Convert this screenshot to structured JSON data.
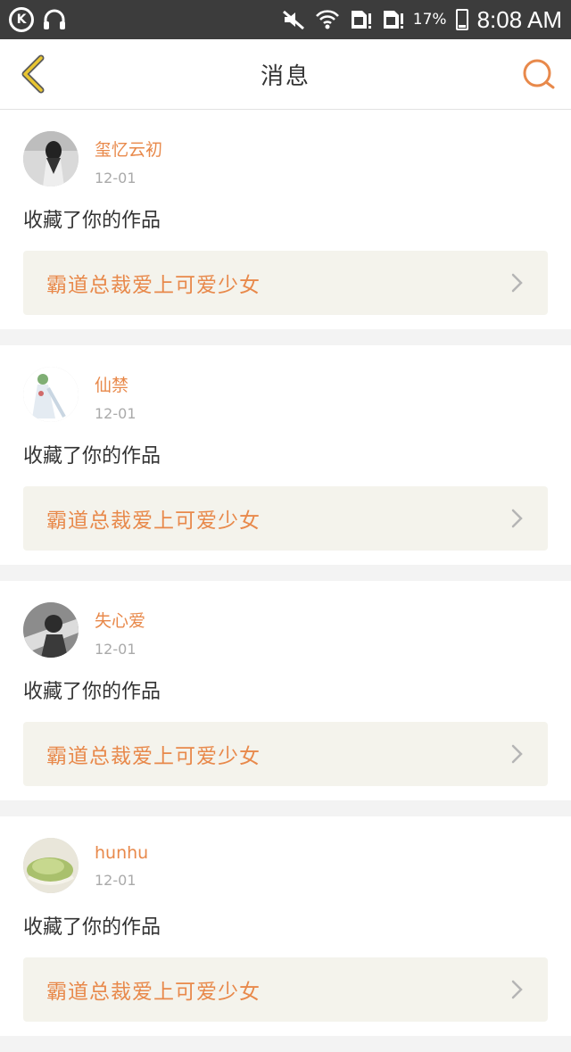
{
  "status_bar": {
    "left_icon_letter": "K",
    "headphones_icon": "headphones-icon",
    "battery_percent": "17%",
    "time": "8:08 AM"
  },
  "header": {
    "title": "消息"
  },
  "messages": [
    {
      "username": "玺忆云初",
      "date": "12-01",
      "action": "收藏了你的作品",
      "work_title": "霸道总裁爱上可爱少女"
    },
    {
      "username": "仙禁",
      "date": "12-01",
      "action": "收藏了你的作品",
      "work_title": "霸道总裁爱上可爱少女"
    },
    {
      "username": "失心爱",
      "date": "12-01",
      "action": "收藏了你的作品",
      "work_title": "霸道总裁爱上可爱少女"
    },
    {
      "username": "hunhu",
      "date": "12-01",
      "action": "收藏了你的作品",
      "work_title": "霸道总裁爱上可爱少女"
    }
  ],
  "colors": {
    "accent": "#e8894b",
    "back_arrow": "#e8c531",
    "work_box": "#f4f3ec"
  }
}
